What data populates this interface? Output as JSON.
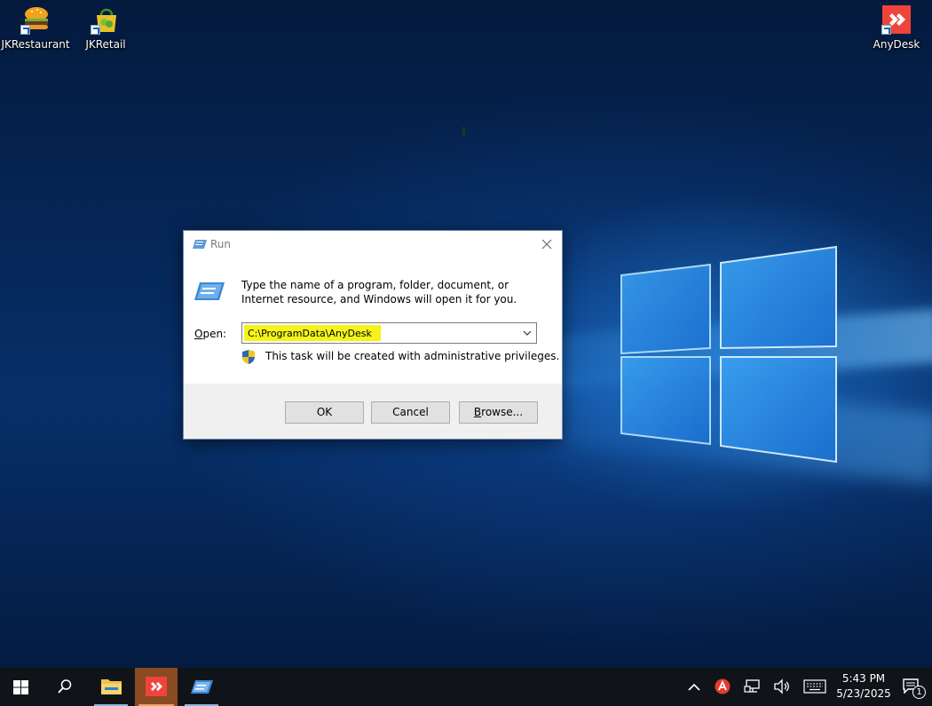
{
  "desktop": {
    "icons": [
      {
        "label": "JKRestaurant",
        "icon": "burger-shortcut-icon"
      },
      {
        "label": "JKRetail",
        "icon": "shopping-bag-shortcut-icon"
      },
      {
        "label": "AnyDesk",
        "icon": "anydesk-shortcut-icon"
      }
    ]
  },
  "run_dialog": {
    "title": "Run",
    "description": "Type the name of a program, folder, document, or Internet resource, and Windows will open it for you.",
    "open_label_accesskey": "O",
    "open_label_rest": "pen:",
    "open_value": "C:\\ProgramData\\AnyDesk",
    "admin_note": "This task will be created with administrative privileges.",
    "buttons": {
      "ok": "OK",
      "cancel": "Cancel",
      "browse_accesskey": "B",
      "browse_rest": "rowse..."
    }
  },
  "taskbar": {
    "items": [
      "start-button",
      "search-button",
      "file-explorer",
      "anydesk",
      "run"
    ],
    "clock_time": "5:43 PM",
    "clock_date": "5/23/2025",
    "notification_count": "1"
  },
  "colors": {
    "highlight": "#f5f31a",
    "anydesk_red": "#ef443b",
    "taskbar": "#101419"
  }
}
